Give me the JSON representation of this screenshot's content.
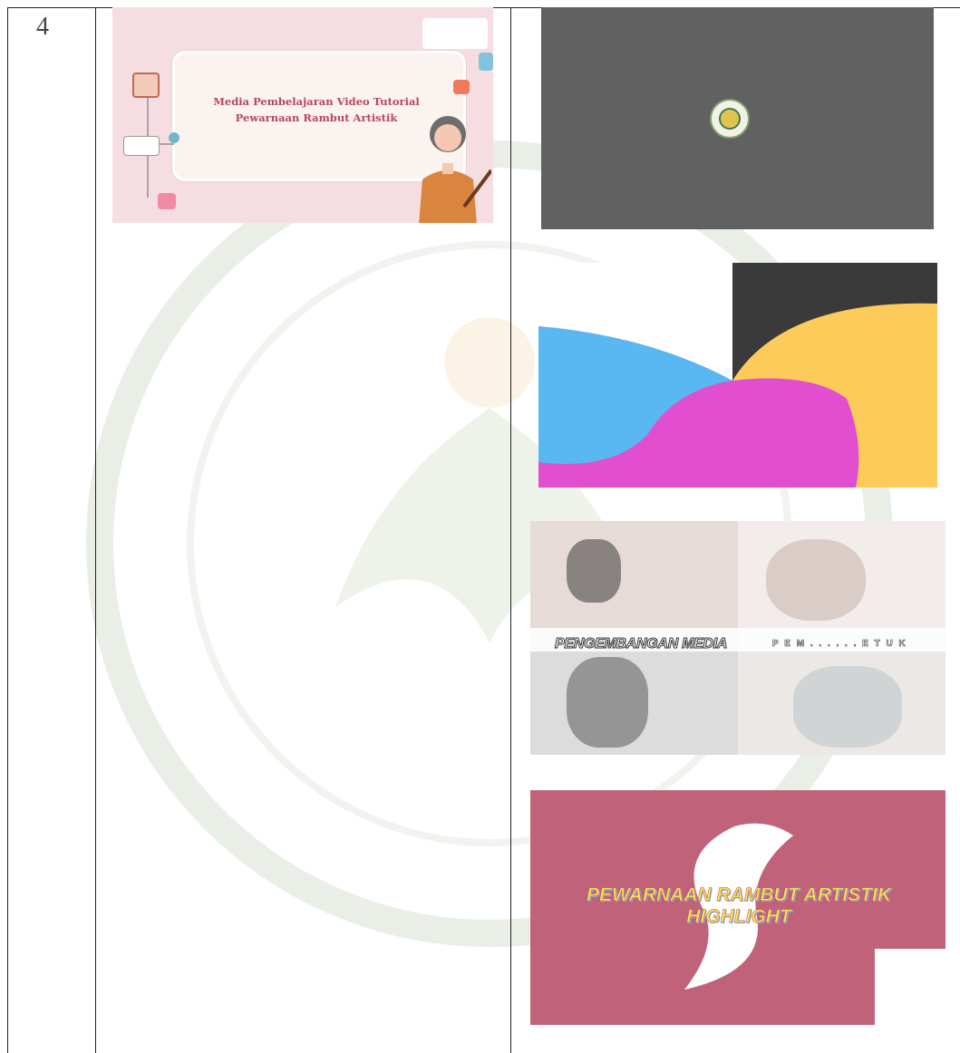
{
  "row": {
    "number": "4"
  },
  "left_slide": {
    "title_line1": "Media Pembelajaran Video Tutorial",
    "title_line2": "Pewarnaan Rambut Artistik"
  },
  "right_images": {
    "banner_title": "PENGEMBANGAN MEDIA",
    "banner_subtitle": "P E M . . . . . . E T U K",
    "highlight_title_line1": "PEWARNAAN RAMBUT ARTISTIK",
    "highlight_title_line2": "HIGHLIGHT"
  },
  "colors": {
    "slide_bg": "#f6dde2",
    "slide_title": "#b5475e",
    "dark_slide": "#616161",
    "blue": "#59b8f2",
    "magenta": "#e14ed0",
    "yellow": "#fccb5a",
    "rose": "#c0637a"
  }
}
